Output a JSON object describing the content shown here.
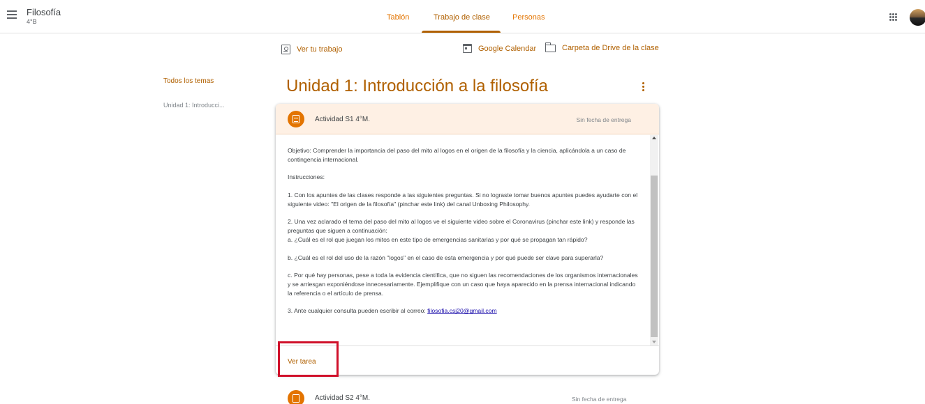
{
  "header": {
    "class_title": "Filosofía",
    "class_subtitle": "4°B",
    "tabs": [
      {
        "label": "Tablón"
      },
      {
        "label": "Trabajo de clase"
      },
      {
        "label": "Personas"
      }
    ],
    "active_tab": "Trabajo de clase",
    "accent_color": "#b06000",
    "tab_color": "#e37400"
  },
  "actions": {
    "view_work": "Ver tu trabajo",
    "google_calendar": "Google Calendar",
    "drive_folder": "Carpeta de Drive de la clase"
  },
  "topics_nav": {
    "all_topics": "Todos los temas",
    "items": [
      "Unidad 1: Introducci..."
    ]
  },
  "topic": {
    "title": "Unidad 1: Introducción a la filosofía"
  },
  "assignment_1": {
    "title": "Actividad S1 4°M.",
    "due": "Sin fecha de entrega",
    "paragraphs": [
      "Objetivo: Comprender la importancia del paso del mito al logos en el origen de la filosofía y la ciencia, aplicándola a un caso de contingencia internacional.",
      "Instrucciones:",
      "1. Con los apuntes de las clases responde a las siguientes preguntas. Si no lograste tomar buenos apuntes puedes ayudarte con el siguiente video: \"El origen de la filosofía\" (pinchar este link) del canal Unboxing Philosophy.",
      "2. Una vez aclarado el tema del paso del mito al logos ve el siguiente video sobre el Coronavirus (pinchar este link) y responde las preguntas que siguen a continuación:",
      "a. ¿Cuál es el rol que juegan los mitos en este tipo de emergencias sanitarias y por qué se propagan tan rápido?",
      "b. ¿Cuál es el rol del uso de la razón \"logos\" en el caso de esta emergencia y por qué puede ser clave para superarla?",
      "c. Por qué hay personas, pese a toda la evidencia científica, que no siguen las recomendaciones de los organismos internacionales y se arriesgan exponiéndose innecesariamente. Ejemplifique con un caso que haya aparecido en la prensa internacional indicando la referencia o el artículo de prensa.",
      "3. Ante cualquier consulta pueden escribir al correo: "
    ],
    "email": "filosofia.csj20@gmail.com",
    "view_task": "Ver tarea"
  },
  "assignment_2": {
    "title": "Actividad S2 4°M.",
    "due": "Sin fecha de entrega"
  }
}
